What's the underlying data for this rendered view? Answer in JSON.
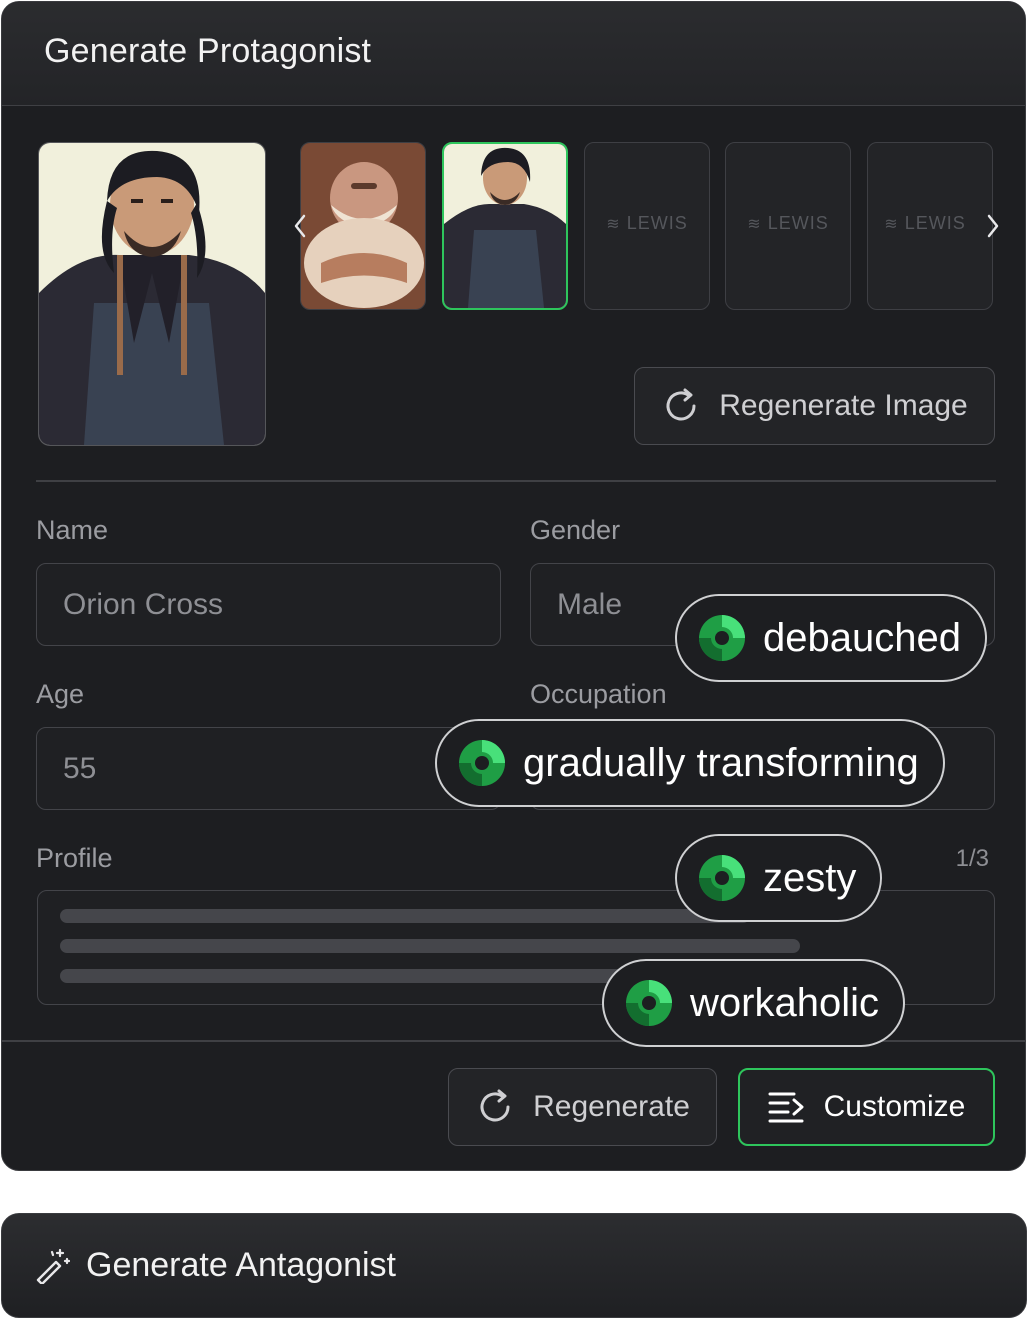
{
  "panel": {
    "title": "Generate Protagonist"
  },
  "gallery": {
    "placeholder_label": "LEWIS",
    "regenerate_image_label": "Regenerate Image"
  },
  "form": {
    "name_label": "Name",
    "name_value": "Orion Cross",
    "gender_label": "Gender",
    "gender_value": "Male",
    "age_label": "Age",
    "age_value": "55",
    "occupation_label": "Occupation",
    "profile_label": "Profile",
    "profile_counter": "1/3"
  },
  "chips": [
    "debauched",
    "gradually transforming",
    "zesty",
    "workaholic"
  ],
  "footer": {
    "regenerate_label": "Regenerate",
    "customize_label": "Customize"
  },
  "bottom_bar": {
    "title": "Generate Antagonist"
  },
  "colors": {
    "accent": "#2ec55c",
    "panel_bg": "#1d1e21",
    "border": "#434449"
  }
}
